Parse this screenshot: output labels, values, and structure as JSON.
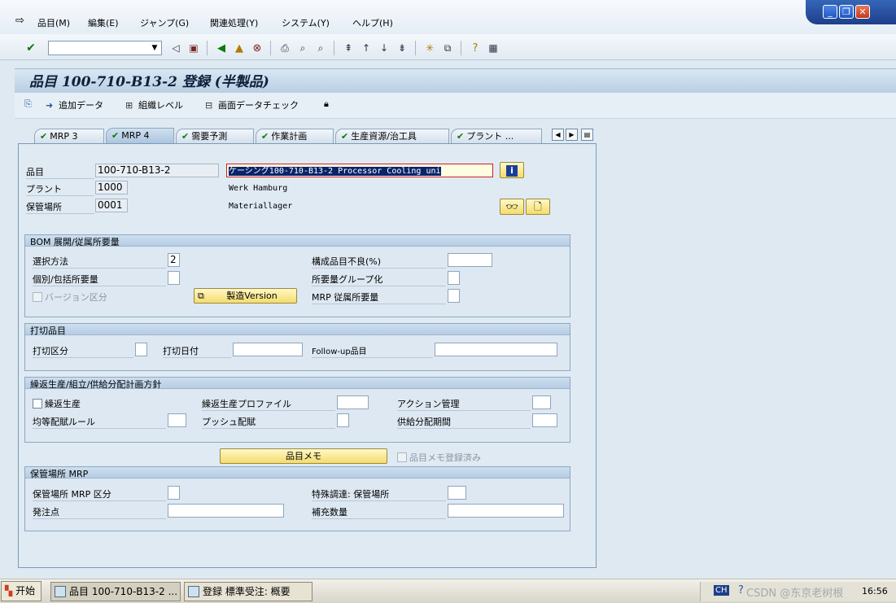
{
  "menubar": {
    "items": [
      "品目(M)",
      "編集(E)",
      "ジャンプ(G)",
      "関連処理(Y)",
      "システム(Y)",
      "ヘルプ(H)"
    ]
  },
  "window_controls": {
    "minimize": "_",
    "restore": "❐",
    "close": "✕"
  },
  "toolbar": {
    "command_field_value": ""
  },
  "title": "品目 100-710-B13-2 登録 (半製品)",
  "app_toolbar": {
    "additional_data": "追加データ",
    "org_levels": "組織レベル",
    "check_screen_data": "画面データチェック"
  },
  "tabs": [
    {
      "label": "MRP 3",
      "active": false
    },
    {
      "label": "MRP 4",
      "active": true
    },
    {
      "label": "需要予測",
      "active": false
    },
    {
      "label": "作業計画",
      "active": false
    },
    {
      "label": "生産資源/治工具",
      "active": false
    },
    {
      "label": "プラント ...",
      "active": false
    }
  ],
  "header": {
    "material_label": "品目",
    "material_value": "100-710-B13-2",
    "material_desc": "ケーシング100-710-B13-2 Processor Cooling uni",
    "plant_label": "プラント",
    "plant_value": "1000",
    "plant_desc": "Werk Hamburg",
    "sloc_label": "保管場所",
    "sloc_value": "0001",
    "sloc_desc": "Materiallager"
  },
  "bom_group": {
    "title": "BOM 展開/従属所要量",
    "selection_method_label": "選択方法",
    "selection_method_value": "2",
    "indiv_coll_label": "個別/包括所要量",
    "version_indicator_label": "バージョン区分",
    "production_version_button": "製造Version",
    "component_scrap_label": "構成品目不良(%)",
    "req_group_label": "所要量グループ化",
    "mrp_dep_req_label": "MRP 従属所要量"
  },
  "discontinued_group": {
    "title": "打切品目",
    "disc_indicator_label": "打切区分",
    "eff_out_label": "打切日付",
    "followup_label": "Follow-up品目"
  },
  "repetitive_group": {
    "title": "繰返生産/組立/供給分配計画方針",
    "repetitive_mfg_label": "繰返生産",
    "rem_profile_label": "繰返生産プロファイル",
    "action_control_label": "アクション管理",
    "fair_share_label": "均等配賦ルール",
    "push_dist_label": "プッシュ配賦",
    "deploy_horizon_label": "供給分配期間"
  },
  "material_memo": {
    "button": "品目メモ",
    "checkbox_label": "品目メモ登録済み"
  },
  "sloc_mrp_group": {
    "title": "保管場所 MRP",
    "sloc_mrp_ind_label": "保管場所 MRP 区分",
    "special_proc_label": "特殊調達: 保管場所",
    "reorder_point_label": "発注点",
    "replenishment_qty_label": "補充数量"
  },
  "taskbar": {
    "start": "开始",
    "tasks": [
      "品目 100-710-B13-2 ...",
      "登録 標準受注: 概要"
    ],
    "lang": "CH",
    "watermark": "CSDN @东京老树根",
    "clock": "16:56"
  }
}
